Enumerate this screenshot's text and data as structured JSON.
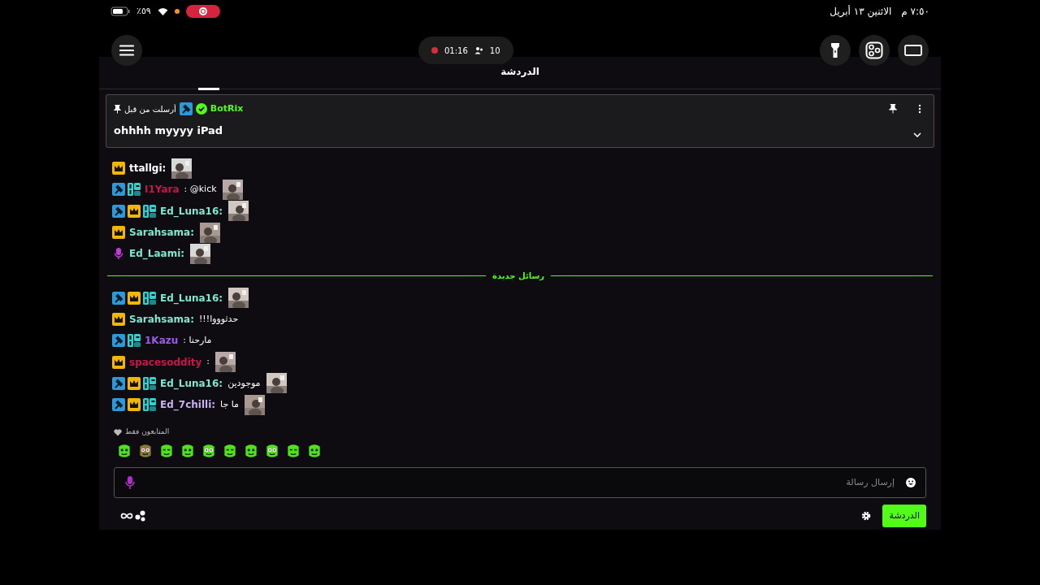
{
  "status_bar": {
    "time": "٧:٥٠ م",
    "date": "الاثنين ١٣ أبريل",
    "battery": "٪٥٩",
    "recording": true
  },
  "live_pill": {
    "duration": "01:16",
    "viewers": "10"
  },
  "header": {
    "title": "الدردشة"
  },
  "pinned": {
    "username": "BotRix",
    "sent_by": "أرسلت من قبل",
    "message": "ohhhh myyyy iPad"
  },
  "messages": [
    {
      "kind": "message",
      "badges": [
        {
          "kind": "sub"
        }
      ],
      "username": "ttallgi:",
      "color": "#ffffff",
      "emote": true
    },
    {
      "kind": "message",
      "badges": [
        {
          "kind": "mod"
        },
        {
          "kind": "og"
        }
      ],
      "username": "I1Yara",
      "color": "#c8174a",
      "text": ": @kick",
      "emote": true
    },
    {
      "kind": "message",
      "badges": [
        {
          "kind": "mod"
        },
        {
          "kind": "sub"
        },
        {
          "kind": "og"
        }
      ],
      "username": "Ed_Luna16:",
      "color": "#7ee8d0",
      "emote": true
    },
    {
      "kind": "message",
      "badges": [
        {
          "kind": "sub"
        }
      ],
      "username": "Sarahsama:",
      "color": "#7ee8d0",
      "emote": true
    },
    {
      "kind": "message",
      "badges": [
        {
          "kind": "mic"
        }
      ],
      "username": "Ed_Laami:",
      "color": "#7ee8d0",
      "emote": true
    },
    {
      "kind": "divider",
      "label": "رسائل جديدة"
    },
    {
      "kind": "message",
      "badges": [
        {
          "kind": "mod"
        },
        {
          "kind": "sub"
        },
        {
          "kind": "og"
        }
      ],
      "username": "Ed_Luna16:",
      "color": "#7ee8d0",
      "emote": true
    },
    {
      "kind": "message",
      "badges": [
        {
          "kind": "sub"
        }
      ],
      "username": "Sarahsama:",
      "color": "#7ee8d0",
      "text": "!!!حدثوووا",
      "emote": false
    },
    {
      "kind": "message",
      "badges": [
        {
          "kind": "mod"
        },
        {
          "kind": "og"
        }
      ],
      "username": "1Kazu",
      "color": "#9b5de5",
      "text": ": مارحنا",
      "emote": false
    },
    {
      "kind": "message",
      "badges": [
        {
          "kind": "sub"
        }
      ],
      "username": "spacesoddity",
      "color": "#c8174a",
      "text": ":",
      "emote": true
    },
    {
      "kind": "message",
      "badges": [
        {
          "kind": "mod"
        },
        {
          "kind": "sub"
        },
        {
          "kind": "og"
        }
      ],
      "username": "Ed_Luna16:",
      "color": "#7ee8d0",
      "text": "موجودين",
      "emote": true
    },
    {
      "kind": "message",
      "badges": [
        {
          "kind": "mod"
        },
        {
          "kind": "sub"
        },
        {
          "kind": "og"
        }
      ],
      "username": "Ed_7chilli:",
      "color": "#c9b0f2",
      "text": "ما جا",
      "emote": true
    }
  ],
  "followers_only": "المتابعون فقط",
  "input": {
    "placeholder": "إرسال رسالة"
  },
  "chat_button": "الدردشة"
}
